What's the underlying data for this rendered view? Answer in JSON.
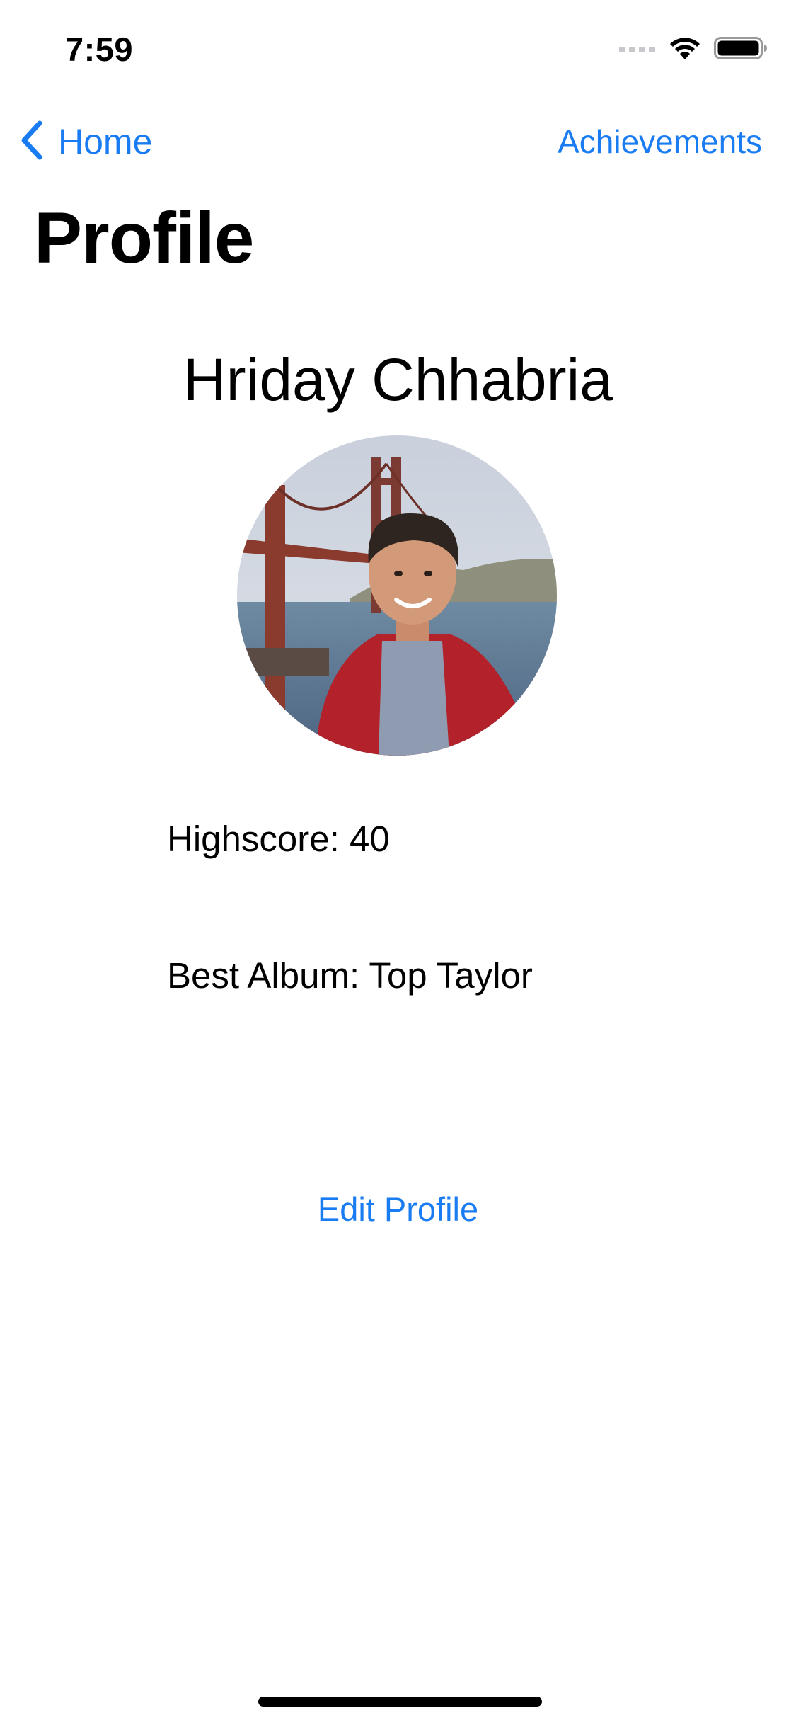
{
  "status_bar": {
    "time": "7:59",
    "icons": [
      "cellular-signal-icon",
      "wifi-icon",
      "battery-icon"
    ]
  },
  "nav": {
    "back_label": "Home",
    "right_action_label": "Achievements",
    "back_icon": "chevron-left-icon"
  },
  "page": {
    "title": "Profile"
  },
  "profile": {
    "name": "Hriday Chhabria",
    "avatar_icon": "avatar-photo",
    "highscore_label": "Highscore:",
    "highscore_value": "40",
    "best_album_label": "Best Album:",
    "best_album_value": "Top Taylor"
  },
  "actions": {
    "edit_profile_label": "Edit Profile"
  },
  "colors": {
    "accent": "#1a7cf2",
    "text": "#000000",
    "background": "#ffffff"
  }
}
